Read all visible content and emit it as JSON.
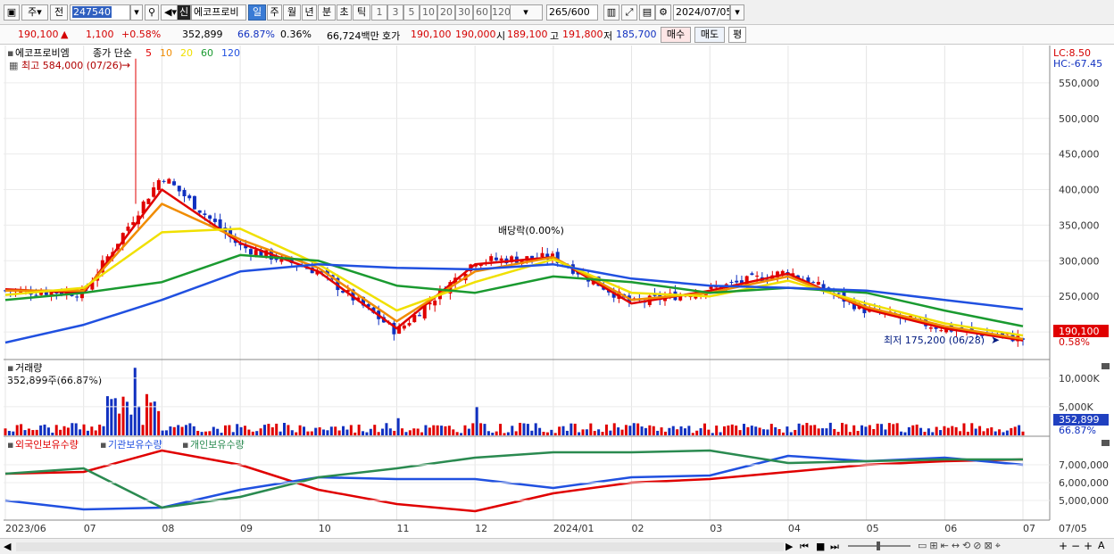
{
  "toolbar": {
    "market_label": "주",
    "prev_label": "전",
    "code": "247540",
    "shin_label": "신",
    "name": "에코프로비",
    "periods": [
      "일",
      "주",
      "월",
      "년",
      "분",
      "초",
      "틱"
    ],
    "active_period": "일",
    "counts": [
      "1",
      "3",
      "5",
      "10",
      "20",
      "30",
      "60",
      "120"
    ],
    "view_range": "265",
    "view_total": "/600",
    "date": "2024/07/05"
  },
  "info": {
    "price": "190,100",
    "arrow": "▲",
    "change": "1,100",
    "change_pct": "+0.58%",
    "volume": "352,899",
    "vol_ratio": "66.87%",
    "turnover": "0.36%",
    "amount": "66,724백만",
    "quote_label": "호가",
    "ask": "190,100",
    "bid": "190,000",
    "open_label": "시",
    "open": "189,100",
    "high_label": "고",
    "high": "191,800",
    "low_label": "저",
    "low": "185,700",
    "buy_btn": "매수",
    "sell_btn": "매도",
    "eval_btn": "평"
  },
  "price_pane": {
    "legend_name": "에코프로비엠",
    "legend_close": "종가 단순",
    "ma_labels": [
      "5",
      "10",
      "20",
      "60",
      "120"
    ],
    "ma_colors": [
      "#e00000",
      "#f08c00",
      "#f0e000",
      "#1a9a30",
      "#2050e0"
    ],
    "lc": "LC:8.50",
    "hc": "HC:-67.45",
    "high_note": "최고 584,000 (07/26)",
    "low_note": "최저 175,200 (06/28)",
    "dividend_note": "배당락(0.00%)",
    "y_ticks": [
      "550,000",
      "500,000",
      "450,000",
      "400,000",
      "350,000",
      "300,000",
      "250,000",
      "200,000"
    ],
    "last_price": "190,100",
    "last_pct": "0.58%"
  },
  "volume_pane": {
    "title": "거래량",
    "subtitle": "352,899주(66.87%)",
    "y_ticks": [
      "10,000K",
      "5,000K"
    ],
    "last_volume": "352,899",
    "last_ratio": "66.87%"
  },
  "holdings_pane": {
    "legend": [
      "외국인보유수량",
      "기관보유수량",
      "개인보유수량"
    ],
    "colors": [
      "#e00000",
      "#2050e0",
      "#2a8a50"
    ],
    "y_ticks": [
      "7,000,000",
      "6,000,000",
      "5,000,000"
    ]
  },
  "x_axis": {
    "labels": [
      "2023/06",
      "07",
      "08",
      "09",
      "10",
      "11",
      "12",
      "2024/01",
      "02",
      "03",
      "04",
      "05",
      "06",
      "07",
      "07/05"
    ]
  },
  "chart_data": {
    "type": "line",
    "title": "",
    "price": {
      "x": [
        "2023/06",
        "07",
        "08",
        "09",
        "10",
        "11",
        "12",
        "2024/01",
        "02",
        "03",
        "04",
        "05",
        "06",
        "07"
      ],
      "close": [
        258000,
        255000,
        420000,
        320000,
        285000,
        200000,
        300000,
        305000,
        240000,
        260000,
        285000,
        230000,
        205000,
        190100
      ],
      "ylim": [
        170000,
        590000
      ],
      "annotations": {
        "max": 584000,
        "min": 175200
      }
    },
    "moving_averages": [
      {
        "name": "5",
        "values": [
          260000,
          255000,
          400000,
          325000,
          285000,
          205000,
          295000,
          305000,
          240000,
          258000,
          282000,
          232000,
          205000,
          188000
        ]
      },
      {
        "name": "10",
        "values": [
          258000,
          258000,
          380000,
          330000,
          290000,
          215000,
          285000,
          305000,
          245000,
          255000,
          278000,
          235000,
          208000,
          190000
        ]
      },
      {
        "name": "20",
        "values": [
          252000,
          262000,
          340000,
          345000,
          295000,
          230000,
          270000,
          302000,
          255000,
          250000,
          272000,
          240000,
          212000,
          195000
        ]
      },
      {
        "name": "60",
        "values": [
          245000,
          255000,
          270000,
          308000,
          300000,
          265000,
          255000,
          278000,
          270000,
          255000,
          262000,
          255000,
          230000,
          208000
        ]
      },
      {
        "name": "120",
        "values": [
          185000,
          210000,
          245000,
          285000,
          295000,
          290000,
          288000,
          295000,
          275000,
          265000,
          262000,
          258000,
          245000,
          232000
        ]
      }
    ],
    "volume": {
      "ylim": [
        0,
        12000000
      ],
      "peak": 11800000,
      "last": 352899
    },
    "holdings": {
      "ylim": [
        4000000,
        8200000
      ],
      "series": [
        {
          "name": "외국인보유수량",
          "values": [
            6500000,
            6600000,
            7800000,
            7000000,
            5600000,
            4800000,
            4400000,
            5400000,
            6000000,
            6200000,
            6600000,
            7000000,
            7200000,
            7300000
          ]
        },
        {
          "name": "기관보유수량",
          "values": [
            5000000,
            4500000,
            4600000,
            5600000,
            6300000,
            6200000,
            6200000,
            5700000,
            6300000,
            6400000,
            7500000,
            7200000,
            7400000,
            7000000
          ]
        },
        {
          "name": "개인보유수량",
          "values": [
            6500000,
            6800000,
            4600000,
            5200000,
            6300000,
            6800000,
            7400000,
            7700000,
            7700000,
            7800000,
            7100000,
            7200000,
            7300000,
            7300000
          ]
        }
      ]
    }
  }
}
